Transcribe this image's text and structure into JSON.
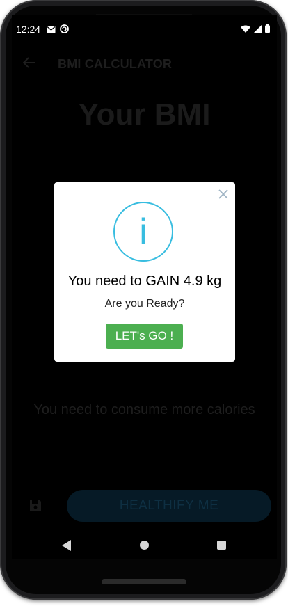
{
  "status_bar": {
    "time": "12:24",
    "left_icons": [
      "gmail-icon",
      "sync-icon"
    ],
    "right_icons": [
      "wifi-icon",
      "signal-icon",
      "battery-icon"
    ]
  },
  "app_bar": {
    "title": "BMI CALCULATOR",
    "back_icon": "arrow-left-icon"
  },
  "main": {
    "heading": "Your BMI",
    "calories_message": "You need to consume more calories",
    "save_icon": "save-icon",
    "healthify_label": "HEALTHIFY ME"
  },
  "dialog": {
    "icon": "info-icon",
    "icon_glyph": "i",
    "title": "You need to GAIN 4.9 kg",
    "subtitle": "Are you Ready?",
    "button_label": "LET's GO !",
    "close_icon": "close-icon"
  },
  "colors": {
    "accent_info": "#38bde0",
    "button_green": "#4caf50",
    "overlay_dark": "#000000"
  }
}
